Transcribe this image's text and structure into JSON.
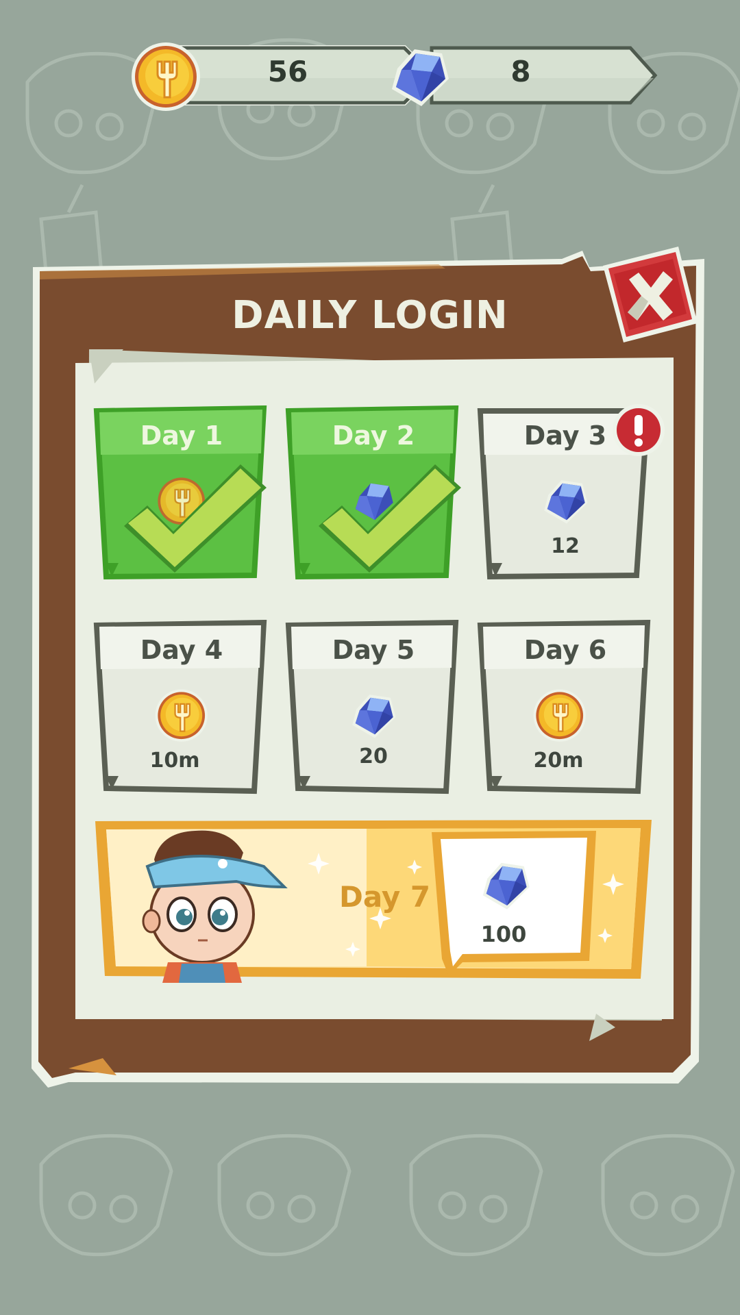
{
  "currency": {
    "coins": "56",
    "gems": "8"
  },
  "panel": {
    "title": "DAILY LOGIN"
  },
  "days": [
    {
      "label": "Day 1",
      "reward_icon": "coin-icon",
      "amount": "",
      "claimed": true
    },
    {
      "label": "Day 2",
      "reward_icon": "gem-icon",
      "amount": "",
      "claimed": true
    },
    {
      "label": "Day 3",
      "reward_icon": "gem-icon",
      "amount": "12",
      "claimed": false,
      "alert": true
    },
    {
      "label": "Day 4",
      "reward_icon": "coin-icon",
      "amount": "10m",
      "claimed": false
    },
    {
      "label": "Day 5",
      "reward_icon": "gem-icon",
      "amount": "20",
      "claimed": false
    },
    {
      "label": "Day 6",
      "reward_icon": "coin-icon",
      "amount": "20m",
      "claimed": false
    }
  ],
  "day7": {
    "label": "Day 7",
    "reward_icon": "gem-icon",
    "amount": "100"
  },
  "colors": {
    "background": "#97a69b",
    "panel_brown": "#7a4c2f",
    "paper": "#eaefe3",
    "claimed_green": "#5cc043",
    "check": "#b7dc55",
    "close_red": "#d23a3c",
    "gold_band": "#e9a634",
    "text_dark": "#3e463e"
  }
}
